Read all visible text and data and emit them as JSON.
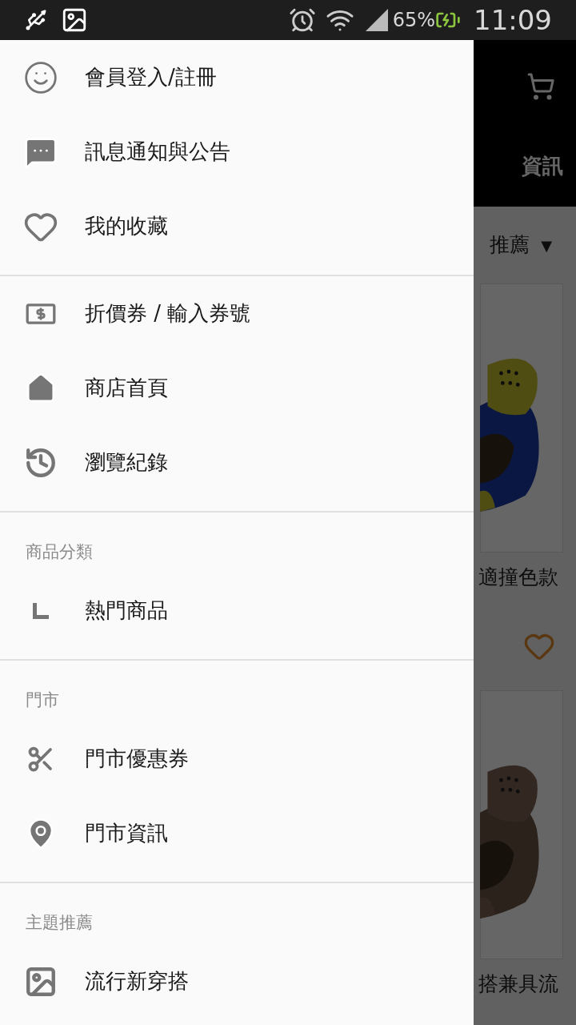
{
  "status_bar": {
    "battery": "65%",
    "time": "11:09"
  },
  "drawer": {
    "sections": [
      {
        "items": [
          {
            "label": "會員登入/註冊"
          },
          {
            "label": "訊息通知與公告"
          },
          {
            "label": "我的收藏"
          }
        ]
      },
      {
        "items": [
          {
            "label": "折價券 / 輸入券號"
          },
          {
            "label": "商店首頁"
          },
          {
            "label": "瀏覽紀錄"
          }
        ]
      },
      {
        "header": "商品分類",
        "items": [
          {
            "label": "熱門商品"
          }
        ]
      },
      {
        "header": "門市",
        "items": [
          {
            "label": "門市優惠券"
          },
          {
            "label": "門市資訊"
          }
        ]
      },
      {
        "header": "主題推薦",
        "items": [
          {
            "label": "流行新穿搭"
          }
        ]
      }
    ]
  },
  "background": {
    "app_bar": {
      "title": "資訊"
    },
    "sort": {
      "label": "推薦",
      "arrow": "▼"
    },
    "products": [
      {
        "name": "適撞色款"
      },
      {
        "name": "搭兼具流"
      }
    ]
  }
}
